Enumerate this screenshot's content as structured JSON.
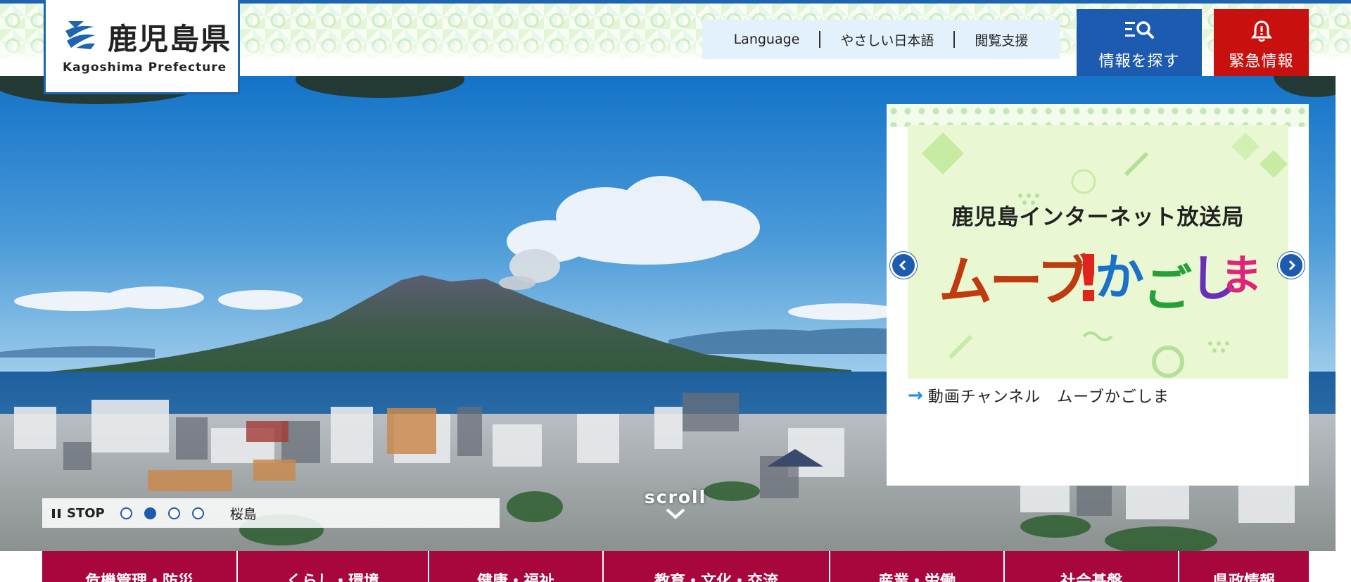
{
  "header": {
    "logo_name": "鹿児島県",
    "logo_en": "Kagoshima Prefecture",
    "utility_links": [
      "Language",
      "やさしい日本語",
      "閲覧支援"
    ],
    "search_label": "情報を探す",
    "emergency_label": "緊急情報"
  },
  "hero": {
    "stop_label": "STOP",
    "slide_count": 4,
    "active_slide": 2,
    "caption": "桜島",
    "scroll_label": "scroll"
  },
  "feature": {
    "banner_title": "鹿児島インターネット放送局",
    "banner_logo_text": "ムーブ!かごしま",
    "link_text": "動画チャンネル　ムーブかごしま"
  },
  "nav": {
    "items": [
      "危機管理・防災",
      "くらし・環境",
      "健康・福祉",
      "教育・文化・交流",
      "産業・労働",
      "社会基盤",
      "県政情報"
    ]
  },
  "colors": {
    "brand_blue": "#1d5bb0",
    "emergency_red": "#c8100e",
    "nav_crimson": "#a8073e",
    "utility_bg": "#e2f1fb",
    "banner_bg": "#e9f8d3"
  },
  "icons": {
    "search": "search-list-icon",
    "emergency": "bell-icon",
    "pause": "pause-icon",
    "prev": "chevron-left-icon",
    "next": "chevron-right-icon",
    "scroll": "chevron-down-icon",
    "link": "arrow-right-icon"
  }
}
